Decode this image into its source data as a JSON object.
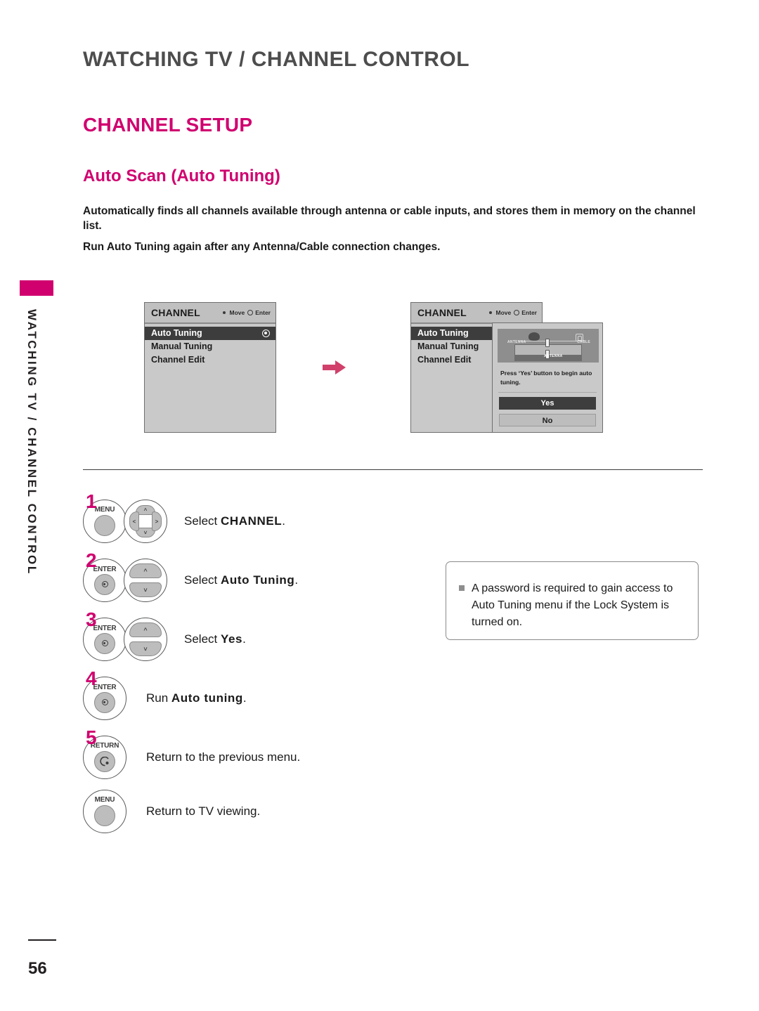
{
  "header": {
    "title": "WATCHING TV / CHANNEL CONTROL"
  },
  "section": {
    "title": "CHANNEL SETUP",
    "subtitle": "Auto Scan (Auto Tuning)"
  },
  "intro": {
    "paragraph_1": "Automatically finds all channels available through antenna or cable inputs, and stores them in memory on the channel list.",
    "paragraph_2": "Run Auto Tuning again after any Antenna/Cable connection changes."
  },
  "side_tab": {
    "label": "WATCHING TV / CHANNEL CONTROL"
  },
  "osd": {
    "title": "CHANNEL",
    "hint_move": "Move",
    "hint_enter": "Enter",
    "items": [
      {
        "label": "Auto Tuning",
        "selected": true
      },
      {
        "label": "Manual Tuning",
        "selected": false
      },
      {
        "label": "Channel Edit",
        "selected": false
      }
    ]
  },
  "dialog": {
    "message": "Press ‘Yes’ button to begin auto tuning.",
    "yes_label": "Yes",
    "no_label": "No",
    "graphic": {
      "antenna_label": "ANTENNA",
      "cable_label": "CABLE",
      "tv_label": "ANTENNA"
    }
  },
  "steps": [
    {
      "number": "1",
      "buttons": [
        "MENU",
        "navpad"
      ],
      "text_prefix": "Select ",
      "text_bold": "CHANNEL",
      "text_suffix": "."
    },
    {
      "number": "2",
      "buttons": [
        "ENTER",
        "updownpad"
      ],
      "text_prefix": "Select ",
      "text_bold": "Auto Tuning",
      "text_suffix": "."
    },
    {
      "number": "3",
      "buttons": [
        "ENTER",
        "updownpad"
      ],
      "text_prefix": "Select ",
      "text_bold": "Yes",
      "text_suffix": "."
    },
    {
      "number": "4",
      "buttons": [
        "ENTER"
      ],
      "text_prefix": "Run ",
      "text_bold": "Auto tuning",
      "text_suffix": "."
    },
    {
      "number": "5",
      "buttons": [
        "RETURN"
      ],
      "text_prefix": "Return to the previous menu.",
      "text_bold": "",
      "text_suffix": ""
    },
    {
      "number": "",
      "buttons": [
        "MENU"
      ],
      "text_prefix": "Return to TV viewing.",
      "text_bold": "",
      "text_suffix": ""
    }
  ],
  "button_captions": {
    "menu": "MENU",
    "enter": "ENTER",
    "return": "RETURN"
  },
  "note": {
    "text": "A password is required to gain access to Auto Tuning menu if the Lock System is turned on."
  },
  "footer": {
    "page_number": "56"
  },
  "colors": {
    "accent": "#d0006f",
    "text": "#231f20",
    "osd_background": "#c9c9c9",
    "osd_selected": "#3d3d3d"
  }
}
